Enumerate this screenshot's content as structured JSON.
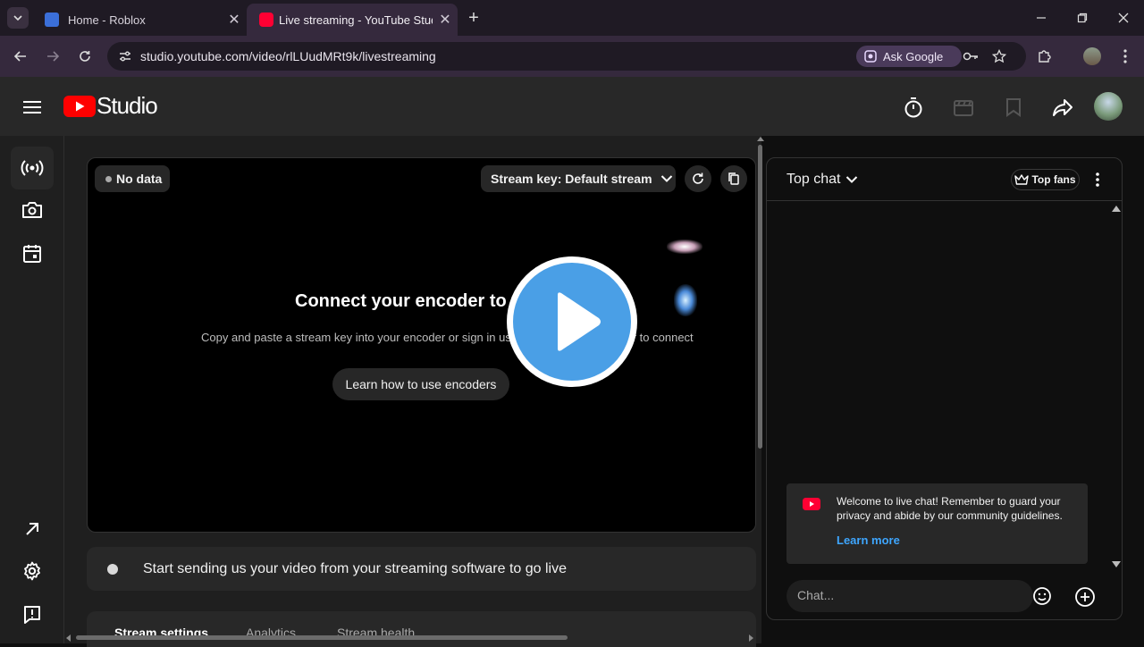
{
  "browser": {
    "tabs": [
      {
        "title": "Home - Roblox",
        "active": false
      },
      {
        "title": "Live streaming - YouTube Studio",
        "active": true
      }
    ],
    "url": "studio.youtube.com/video/rlLUudMRt9k/livestreaming",
    "ask_google_label": "Ask Google"
  },
  "studio": {
    "logo_text": "Studio"
  },
  "preview": {
    "no_data_label": "No data",
    "stream_key_label": "Stream key: Default stream",
    "connect_title": "Connect your encoder to go live",
    "connect_subtitle": "Copy and paste a stream key into your encoder or sign in using a supported encoder to connect",
    "learn_button": "Learn how to use encoders"
  },
  "status": {
    "text": "Start sending us your video from your streaming software to go live"
  },
  "bottom_tabs": [
    "Stream settings",
    "Analytics",
    "Stream health"
  ],
  "chat": {
    "mode_label": "Top chat",
    "top_fans_label": "Top fans",
    "welcome_message": "Welcome to live chat! Remember to guard your privacy and abide by our community guidelines.",
    "learn_more": "Learn more",
    "input_placeholder": "Chat..."
  },
  "colors": {
    "youtube_red": "#ff0000",
    "link_blue": "#3ea6ff",
    "play_blue": "#4a9fe6"
  }
}
